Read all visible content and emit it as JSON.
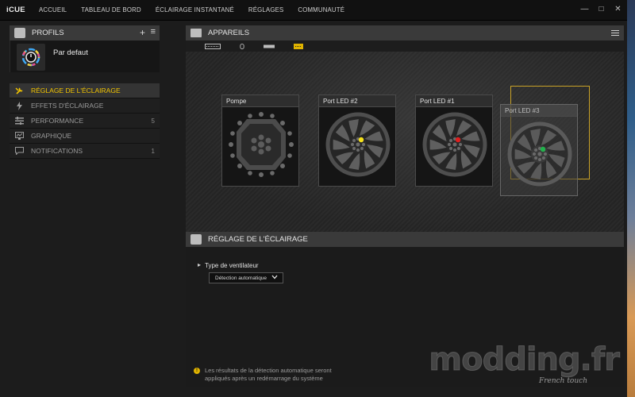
{
  "app": {
    "logo": "iCUE"
  },
  "nav": [
    "ACCUEIL",
    "TABLEAU DE BORD",
    "ÉCLAIRAGE INSTANTANÉ",
    "RÉGLAGES",
    "COMMUNAUTÉ"
  ],
  "window_controls": {
    "minimize": "—",
    "maximize": "□",
    "close": "✕"
  },
  "profiles": {
    "title": "PROFILS",
    "add": "+",
    "menu": "≡",
    "profile_name": "Par defaut"
  },
  "sidebar": {
    "items": [
      {
        "label": "RÉGLAGE DE L'ÉCLAIRAGE",
        "count": "",
        "icon": "wrench-icon"
      },
      {
        "label": "EFFETS D'ÉCLAIRAGE",
        "count": "",
        "icon": "lightning-icon"
      },
      {
        "label": "PERFORMANCE",
        "count": "5",
        "icon": "sliders-icon"
      },
      {
        "label": "GRAPHIQUE",
        "count": "",
        "icon": "graph-icon"
      },
      {
        "label": "NOTIFICATIONS",
        "count": "1",
        "icon": "chat-icon"
      }
    ]
  },
  "devices": {
    "title": "APPAREILS",
    "cards": [
      {
        "label": "Pompe",
        "led_color": ""
      },
      {
        "label": "Port LED #2",
        "led_color": "#f5e11a"
      },
      {
        "label": "Port LED #1",
        "led_color": "#e01e1e"
      },
      {
        "label": "Port LED #3",
        "led_color": "#22b24c"
      }
    ],
    "accent": "#c9a227"
  },
  "lighting": {
    "title": "RÉGLAGE DE L'ÉCLAIRAGE",
    "fan_type_label": "Type de ventilateur",
    "dropdown_value": "Détection automatique",
    "info_line1": "Les résultats de la détection automatique seront",
    "info_line2": "appliqués après un redémarrage du système"
  },
  "watermark": {
    "main": "modding.fr",
    "sub": "French touch"
  }
}
